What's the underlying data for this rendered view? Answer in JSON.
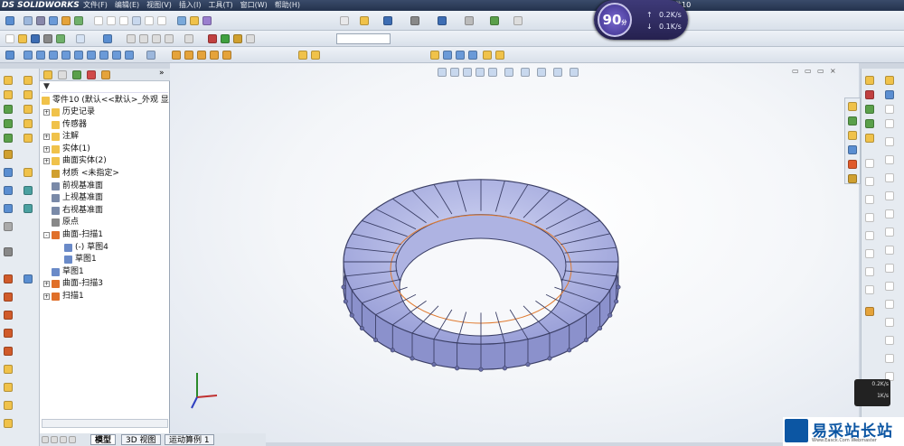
{
  "app": {
    "logo_text": "DS SOLIDWORKS",
    "doc_title": "零件10"
  },
  "menu": [
    "文件(F)",
    "编辑(E)",
    "视图(V)",
    "插入(I)",
    "工具(T)",
    "窗口(W)",
    "帮助(H)"
  ],
  "feature_tree": {
    "root": "零件10 (默认<<默认>_外观 显",
    "items": [
      {
        "label": "历史记录",
        "level": 1,
        "exp": "+"
      },
      {
        "label": "传感器",
        "level": 1,
        "exp": ""
      },
      {
        "label": "注解",
        "level": 1,
        "exp": "+"
      },
      {
        "label": "实体(1)",
        "level": 1,
        "exp": "+"
      },
      {
        "label": "曲面实体(2)",
        "level": 1,
        "exp": "+"
      },
      {
        "label": "材质 <未指定>",
        "level": 1,
        "exp": ""
      },
      {
        "label": "前视基准面",
        "level": 1,
        "exp": ""
      },
      {
        "label": "上视基准面",
        "level": 1,
        "exp": ""
      },
      {
        "label": "右视基准面",
        "level": 1,
        "exp": ""
      },
      {
        "label": "原点",
        "level": 1,
        "exp": ""
      },
      {
        "label": "曲面-扫描1",
        "level": 1,
        "exp": "-"
      },
      {
        "label": "(-) 草图4",
        "level": 2,
        "exp": ""
      },
      {
        "label": "草图1",
        "level": 2,
        "exp": ""
      },
      {
        "label": "草图1",
        "level": 1,
        "exp": ""
      },
      {
        "label": "曲面-扫描3",
        "level": 1,
        "exp": "+"
      },
      {
        "label": "扫描1",
        "level": 1,
        "exp": "+"
      }
    ]
  },
  "bottom_tabs": [
    "模型",
    "3D 视图",
    "运动算例 1"
  ],
  "speed_badge": {
    "score": "90",
    "unit": "分",
    "up": "0.2K/s",
    "down": "0.1K/s"
  },
  "net_mini": {
    "up": "0.2K/s",
    "down": "1K/s"
  },
  "brand": {
    "cn": "易采站长站",
    "en": "Www.Easck.Com  Webmaster"
  },
  "colors": {
    "accent": "#0c56a3",
    "ring_fill": "#b8bde8",
    "ring_edge": "#3b3f66",
    "sweep_line": "#e07a2f"
  }
}
